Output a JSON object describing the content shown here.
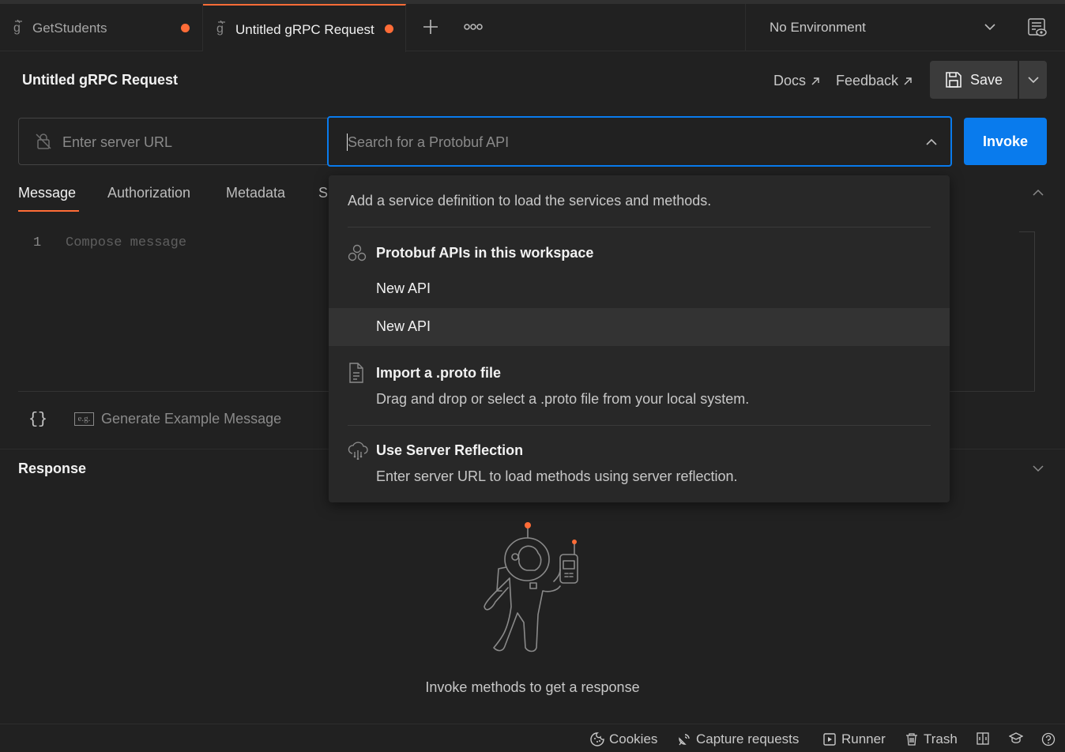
{
  "tabs": [
    {
      "label": "GetStudents",
      "unsaved": true
    },
    {
      "label": "Untitled gRPC Request",
      "unsaved": true,
      "active": true
    }
  ],
  "environment": {
    "selected": "No Environment"
  },
  "request": {
    "title": "Untitled gRPC Request",
    "docs_label": "Docs",
    "feedback_label": "Feedback",
    "save_label": "Save",
    "server_url_placeholder": "Enter server URL",
    "search_placeholder": "Search for a Protobuf API",
    "invoke_label": "Invoke"
  },
  "message_tabs": [
    "Message",
    "Authorization",
    "Metadata",
    "S"
  ],
  "editor": {
    "line_number": "1",
    "placeholder": "Compose message"
  },
  "editor_actions": {
    "braces": "{}",
    "eg_badge": "e.g.",
    "generate_label": "Generate Example Message"
  },
  "dropdown": {
    "hint": "Add a service definition to load the services and methods.",
    "workspace_group": {
      "title": "Protobuf APIs in this workspace",
      "items": [
        "New API",
        "New API"
      ]
    },
    "import_group": {
      "title": "Import a .proto file",
      "description": "Drag and drop or select a .proto file from your local system."
    },
    "reflection_group": {
      "title": "Use Server Reflection",
      "description": "Enter server URL to load methods using server reflection."
    }
  },
  "response": {
    "title": "Response",
    "empty_text": "Invoke methods to get a response"
  },
  "statusbar": {
    "cookies": "Cookies",
    "capture": "Capture requests",
    "runner": "Runner",
    "trash": "Trash"
  },
  "colors": {
    "accent": "#ff6c37",
    "primary": "#097bed",
    "background": "#212121"
  }
}
